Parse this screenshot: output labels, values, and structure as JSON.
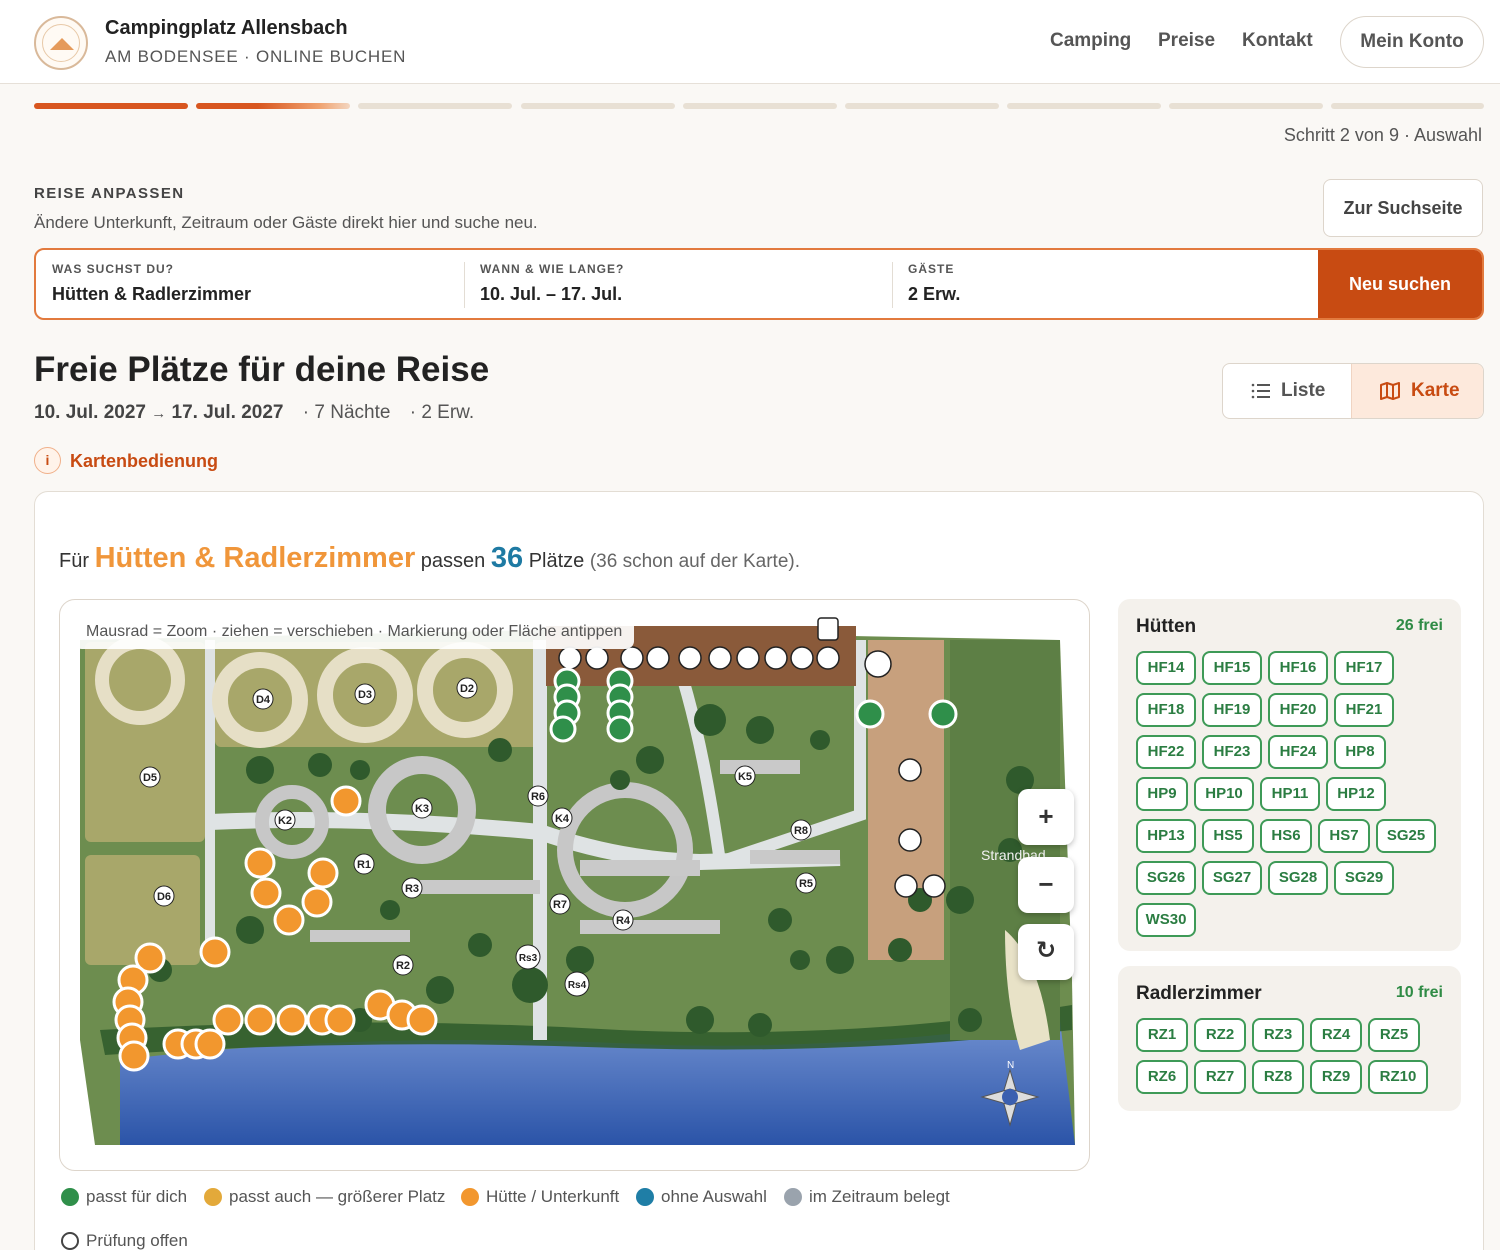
{
  "header": {
    "title": "Campingplatz Allensbach",
    "subtitle": "AM BODENSEE · ONLINE BUCHEN",
    "nav": [
      "Camping",
      "Preise",
      "Kontakt"
    ],
    "account": "Mein Konto"
  },
  "progress": {
    "total": 9,
    "current": 2,
    "text": "Schritt 2 von 9 · Auswahl"
  },
  "adjust": {
    "label": "REISE ANPASSEN",
    "description": "Ändere Unterkunft, Zeitraum oder Gäste direkt hier und suche neu.",
    "to_search": "Zur Suchseite",
    "fields": [
      {
        "label": "WAS SUCHST DU?",
        "value": "Hütten & Radlerzimmer"
      },
      {
        "label": "WANN & WIE LANGE?",
        "value": "10. Jul. – 17. Jul."
      },
      {
        "label": "GÄSTE",
        "value": "2 Erw."
      }
    ],
    "search_button": "Neu suchen"
  },
  "results": {
    "title": "Freie Plätze für deine Reise",
    "date_from": "10. Jul. 2027",
    "arrow": "→",
    "date_to": "17. Jul. 2027",
    "nights": "· 7 Nächte",
    "guests": "· 2 Erw.",
    "view_list": "Liste",
    "view_map": "Karte",
    "info_link": "Kartenbedienung",
    "info_icon": "i"
  },
  "summary": {
    "prefix": "Für",
    "category": "Hütten & Radlerzimmer",
    "middle": "passen",
    "count": "36",
    "unit": "Plätze",
    "note": "(36 schon auf der Karte)."
  },
  "map": {
    "hint": "Mausrad = Zoom · ziehen = verschieben · Markierung oder Fläche antippen",
    "zoom_in": "+",
    "zoom_out": "−",
    "reset_icon": "↻",
    "beach_label": "Strandbad",
    "pitches_a": [
      "D5",
      "D4",
      "D3",
      "D2",
      "D6",
      "K2",
      "K3",
      "K4",
      "K5"
    ],
    "pitches_b": [
      "R1",
      "R2",
      "R3",
      "R4",
      "R5",
      "R6",
      "R7",
      "R8",
      "Rs3",
      "Rs4"
    ],
    "colors": {
      "green": "#2f8f4a",
      "orange": "#f2972e",
      "water": "#3a62b0",
      "grass": "#6d8d4f"
    }
  },
  "huetten": {
    "title": "Hütten",
    "count": "26 frei",
    "items": [
      "HF14",
      "HF15",
      "HF16",
      "HF17",
      "HF18",
      "HF19",
      "HF20",
      "HF21",
      "HF22",
      "HF23",
      "HF24",
      "HP8",
      "HP9",
      "HP10",
      "HP11",
      "HP12",
      "HP13",
      "HS5",
      "HS6",
      "HS7",
      "SG25",
      "SG26",
      "SG27",
      "SG28",
      "SG29",
      "WS30"
    ]
  },
  "radler": {
    "title": "Radlerzimmer",
    "count": "10 frei",
    "items": [
      "RZ1",
      "RZ2",
      "RZ3",
      "RZ4",
      "RZ5",
      "RZ6",
      "RZ7",
      "RZ8",
      "RZ9",
      "RZ10"
    ]
  },
  "legend": [
    {
      "label": "passt für dich",
      "color": "#2f8f4a"
    },
    {
      "label": "passt auch — größerer Platz",
      "color": "#e3a93a"
    },
    {
      "label": "Hütte / Unterkunft",
      "color": "#f2972e"
    },
    {
      "label": "ohne Auswahl",
      "color": "#1f7ea6"
    },
    {
      "label": "im Zeitraum belegt",
      "color": "#9aa3ad"
    },
    {
      "label": "Prüfung offen",
      "color": "#ffffff"
    }
  ]
}
